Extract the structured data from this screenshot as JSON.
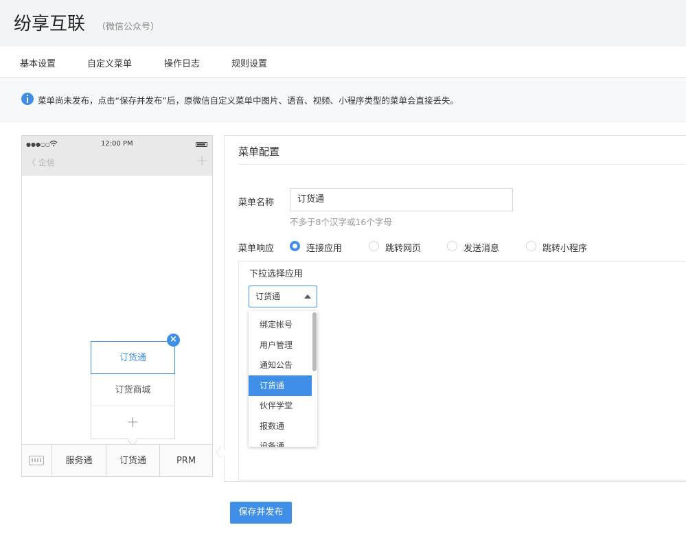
{
  "header": {
    "title": "纷享互联",
    "subtitle": "（微信公众号）"
  },
  "tabs": [
    {
      "label": "基本设置"
    },
    {
      "label": "自定义菜单"
    },
    {
      "label": "操作日志"
    },
    {
      "label": "规则设置"
    }
  ],
  "notice": {
    "text": "菜单尚未发布，点击“保存并发布”后，原微信自定义菜单中图片、语音、视频、小程序类型的菜单会直接丢失。"
  },
  "phone": {
    "signal": "●●●○○",
    "time": "12:00 PM",
    "back_label": "〈 企信",
    "plus": "+",
    "submenu": [
      {
        "label": "订货通"
      },
      {
        "label": "订货商城"
      }
    ],
    "submenu_add": "+",
    "close": "×",
    "bottom": [
      {
        "label": "服务通"
      },
      {
        "label": "订货通"
      },
      {
        "label": "PRM"
      }
    ]
  },
  "config": {
    "heading": "菜单配置",
    "name_label": "菜单名称",
    "name_value": "订货通",
    "name_hint": "不多于8个汉字或16个字母",
    "response_label": "菜单响应",
    "response_options": [
      {
        "label": "连接应用",
        "checked": true
      },
      {
        "label": "跳转网页",
        "checked": false
      },
      {
        "label": "发送消息",
        "checked": false
      },
      {
        "label": "跳转小程序",
        "checked": false
      }
    ],
    "app_select_title": "下拉选择应用",
    "app_selected": "订货通",
    "app_options": [
      "绑定帐号",
      "用户管理",
      "通知公告",
      "订货通",
      "伙伴学堂",
      "报数通",
      "设备通"
    ]
  },
  "save_button": "保存并发布",
  "colors": {
    "accent": "#3f8fe8",
    "tab_underline": "#f08a38"
  }
}
